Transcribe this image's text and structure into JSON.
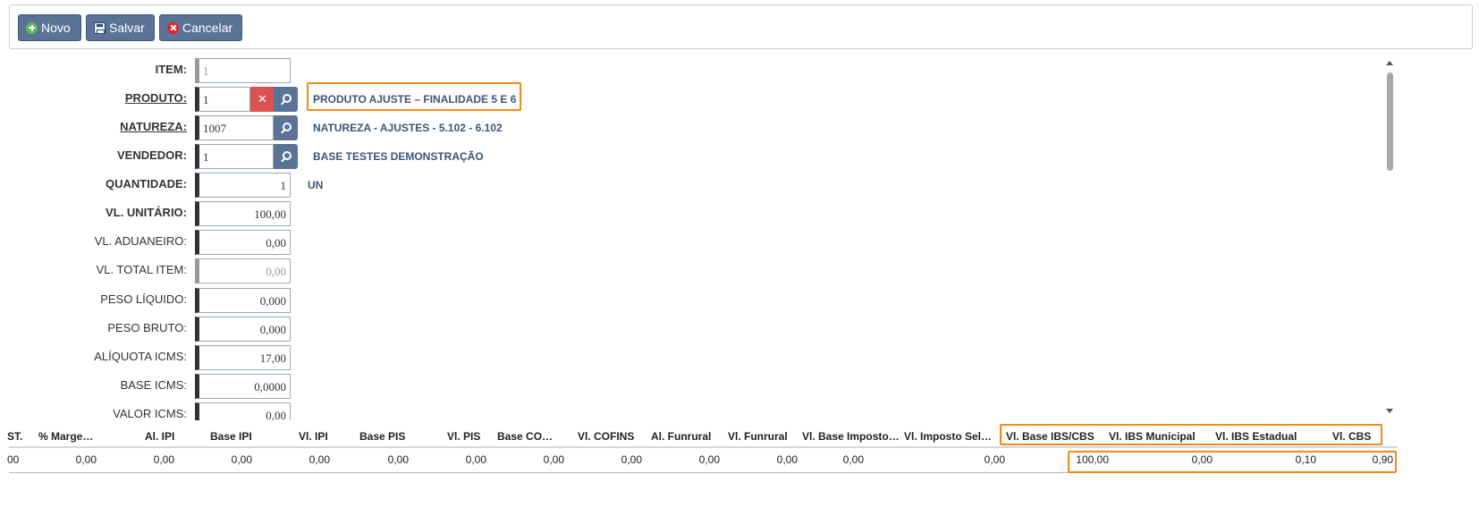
{
  "toolbar": {
    "buttons": [
      {
        "label": "Novo",
        "icon": "plus-circle-icon"
      },
      {
        "label": "Salvar",
        "icon": "floppy-disk-icon"
      },
      {
        "label": "Cancelar",
        "icon": "cancel-circle-icon"
      }
    ]
  },
  "form": {
    "item": {
      "label": "ITEM:",
      "value": "1"
    },
    "produto": {
      "label": "PRODUTO:",
      "value": "1",
      "description": "PRODUTO AJUSTE – FINALIDADE 5 E 6"
    },
    "natureza": {
      "label": "NATUREZA:",
      "value": "1007",
      "description": "NATUREZA - AJUSTES - 5.102 - 6.102"
    },
    "vendedor": {
      "label": "VENDEDOR:",
      "value": "1",
      "description": "BASE TESTES DEMONSTRAÇÃO"
    },
    "quantidade": {
      "label": "QUANTIDADE:",
      "value": "1",
      "unit": "UN"
    },
    "vl_unitario": {
      "label": "VL. UNITÁRIO:",
      "value": "100,00"
    },
    "vl_aduaneiro": {
      "label": "VL. ADUANEIRO:",
      "value": "0,00"
    },
    "vl_total_item": {
      "label": "VL. TOTAL ITEM:",
      "value": "0,00"
    },
    "peso_liquido": {
      "label": "PESO LÍQUIDO:",
      "value": "0,000"
    },
    "peso_bruto": {
      "label": "PESO BRUTO:",
      "value": "0,000"
    },
    "aliquota_icms": {
      "label": "ALÍQUOTA ICMS:",
      "value": "17,00"
    },
    "base_icms": {
      "label": "BASE ICMS:",
      "value": "0,0000"
    },
    "valor_icms": {
      "label": "VALOR ICMS:",
      "value": "0,00"
    }
  },
  "grid": {
    "headers": [
      "ST.",
      "% Marge…",
      "Al. IPI",
      "Base IPI",
      "Vl. IPI",
      "Base PIS",
      "Vl. PIS",
      "Base CO…",
      "Vl. COFINS",
      "Al. Funrural",
      "Vl. Funrural",
      "Vl. Base Imposto…",
      "Vl. Imposto Sel…",
      "Vl. Base IBS/CBS",
      "Vl. IBS Municipal",
      "Vl. IBS Estadual",
      "Vl. CBS"
    ],
    "row": [
      "00",
      "0,00",
      "0,00",
      "0,00",
      "0,00",
      "0,00",
      "0,00",
      "0,00",
      "0,00",
      "0,00",
      "0,00",
      "0,00",
      "0,00",
      "100,00",
      "0,00",
      "0,10",
      "0,90"
    ]
  },
  "colors": {
    "accent": "#5a7396",
    "highlight": "#f28a17",
    "danger": "#d9534f"
  }
}
